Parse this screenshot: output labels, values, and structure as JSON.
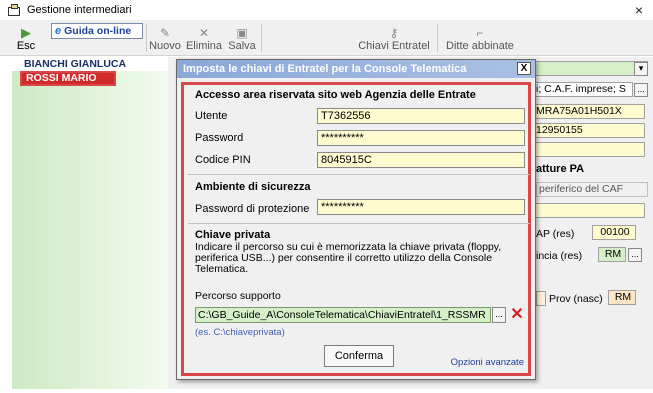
{
  "window": {
    "title": "Gestione intermediari",
    "close_glyph": "×"
  },
  "toolbar": {
    "esc_label": "Esc",
    "guida_label": "Guida on-line",
    "nuovo_label": "Nuovo",
    "elimina_label": "Elimina",
    "salva_label": "Salva",
    "chiavi_label": "Chiavi Entratel",
    "ditte_label": "Ditte abbinate"
  },
  "list": {
    "items": [
      "BIANCHI GIANLUCA",
      "ROSSI MARIO"
    ]
  },
  "background": {
    "caf_field": "i; C.A.F. imprese; S",
    "cf_field": "MRA75A01H501X",
    "piva_field": "12950155",
    "fatture_title": "atture PA",
    "caf_tab": "periferico del CAF",
    "cap_label": "AP (res)",
    "cap_value": "00100",
    "prov_res_label": "incia (res)",
    "prov_res_value": "RM",
    "prov_nasc_label": "Prov (nasc)",
    "prov_nasc_value": "RM"
  },
  "dialog": {
    "title": "Imposta le chiavi di Entratel per la Console Telematica",
    "close_label": "X",
    "section1_title": "Accesso area riservata sito web Agenzia delle Entrate",
    "utente_label": "Utente",
    "utente_value": "T7362556",
    "password_label": "Password",
    "password_value": "**********",
    "pin_label": "Codice PIN",
    "pin_value": "8045915C",
    "section2_title": "Ambiente di sicurezza",
    "protezione_label": "Password di protezione",
    "protezione_value": "**********",
    "section3_title": "Chiave privata",
    "description": "Indicare il percorso su cui è memorizzata la chiave privata (floppy, periferica USB...) per consentire il corretto utilizzo della Console Telematica.",
    "percorso_label": "Percorso supporto",
    "percorso_value": "C:\\GB_Guide_A\\ConsoleTelematica\\ChiaviEntratel\\1_RSSMR",
    "browse_label": "...",
    "hint": "(es. C:\\chiaveprivata)",
    "confirm_label": "Conferma",
    "advanced_label": "Opzioni avanzate"
  },
  "colors": {
    "highlight_red": "#d84848",
    "field_yellow": "#fdfbcf",
    "field_green": "#d5f0c8",
    "title_blue": "#8aa8d8"
  }
}
